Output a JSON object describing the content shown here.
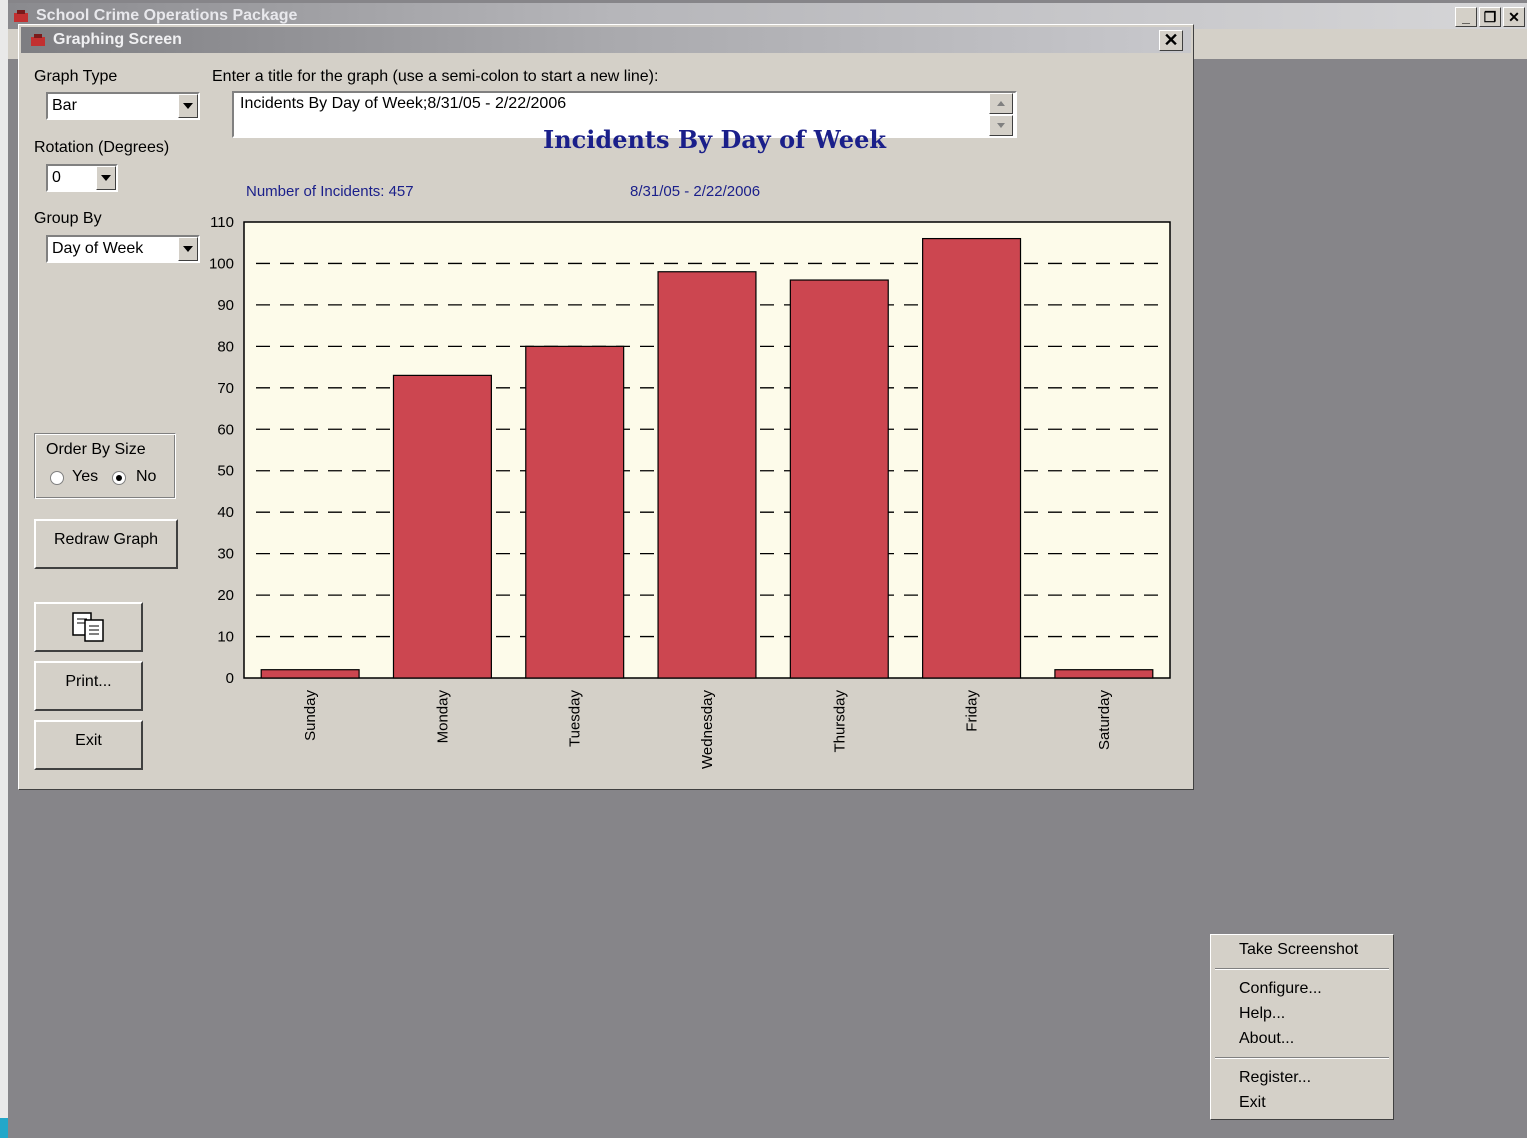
{
  "app": {
    "title": "School Crime Operations Package"
  },
  "dialog": {
    "title": "Graphing Screen",
    "graph_type_label": "Graph Type",
    "graph_type_value": "Bar",
    "rotation_label": "Rotation (Degrees)",
    "rotation_value": "0",
    "group_by_label": "Group By",
    "group_by_value": "Day of Week",
    "title_prompt": "Enter a title for the graph  (use a semi-colon to start a new line):",
    "title_value": "Incidents By Day of Week;8/31/05  -  2/22/2006",
    "order_by_size_label": "Order By Size",
    "order_yes": "Yes",
    "order_no": "No",
    "order_selected": "No",
    "redraw_button": "Redraw Graph",
    "print_button": "Print...",
    "exit_button": "Exit"
  },
  "chart_data": {
    "type": "bar",
    "title": "Incidents By Day of Week",
    "subtitle": "8/31/05  -  2/22/2006",
    "note": "Number of Incidents:  457",
    "categories": [
      "Sunday",
      "Monday",
      "Tuesday",
      "Wednesday",
      "Thursday",
      "Friday",
      "Saturday"
    ],
    "values": [
      2,
      73,
      80,
      98,
      96,
      106,
      2
    ],
    "ylim": [
      0,
      110
    ],
    "yticks": [
      0,
      10,
      20,
      30,
      40,
      50,
      60,
      70,
      80,
      90,
      100,
      110
    ],
    "grid": true,
    "bar_color": "#cc4650",
    "plot_bg": "#fdfbea",
    "title_color": "#1a1f8a"
  },
  "context_menu": {
    "items": [
      "Take Screenshot",
      "Configure...",
      "Help...",
      "About...",
      "Register...",
      "Exit"
    ]
  }
}
